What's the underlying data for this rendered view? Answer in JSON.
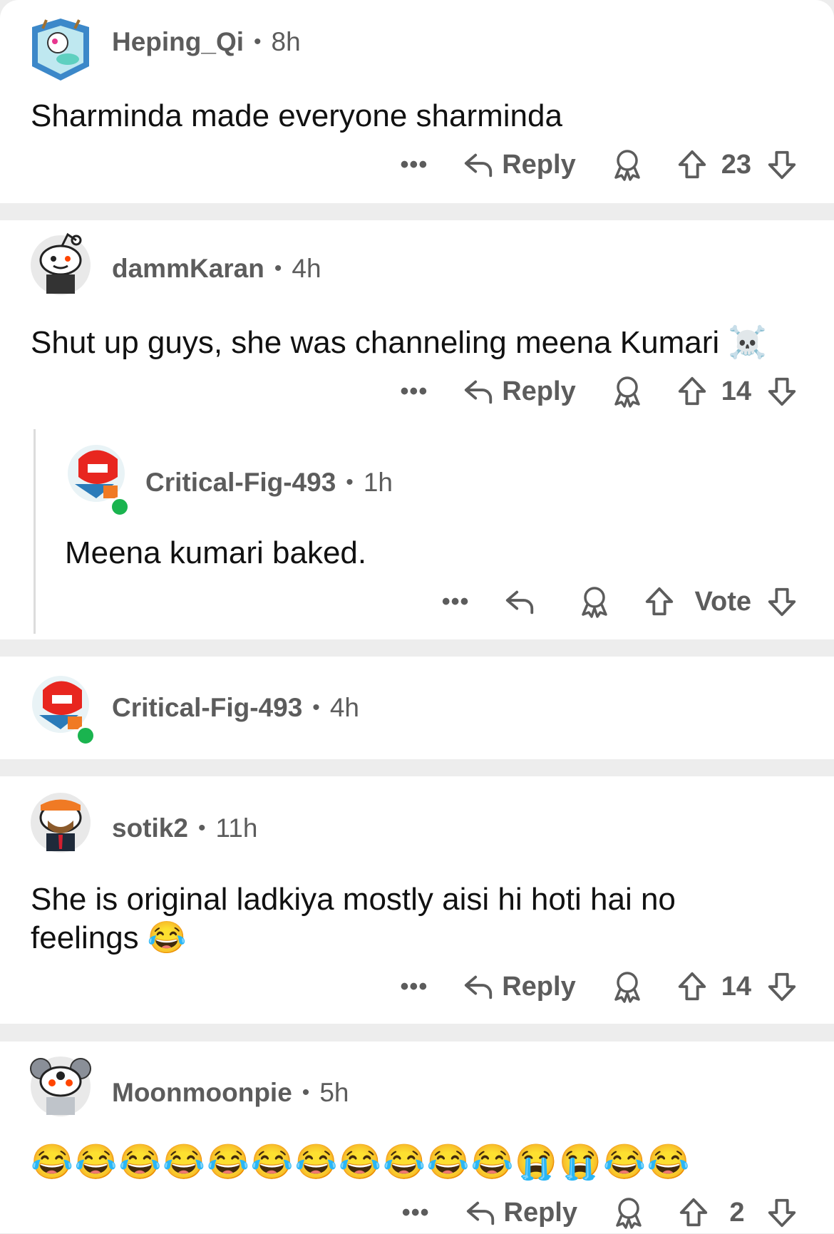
{
  "comments": [
    {
      "username": "Heping_Qi",
      "time": "8h",
      "text": "Sharminda made everyone sharminda",
      "actions": {
        "more": "•••",
        "reply": "Reply",
        "score": "23"
      }
    },
    {
      "username": "dammKaran",
      "time": "4h",
      "text": "Shut up guys, she was channeling meena Kumari",
      "emoji": "☠️",
      "actions": {
        "more": "•••",
        "reply": "Reply",
        "score": "14"
      },
      "replies": [
        {
          "username": "Critical-Fig-493",
          "time": "1h",
          "text": "Meena kumari baked.",
          "actions": {
            "more": "•••",
            "score": "Vote"
          }
        }
      ]
    },
    {
      "username": "Critical-Fig-493",
      "time": "4h"
    },
    {
      "username": "sotik2",
      "time": "11h",
      "text": "She is original ladkiya mostly aisi hi hoti hai no feelings",
      "emoji": "😂",
      "actions": {
        "more": "•••",
        "reply": "Reply",
        "score": "14"
      }
    },
    {
      "username": "Moonmoonpie",
      "time": "5h",
      "emojis": "😂😂😂😂😂😂😂😂😂😂😂😭😭😂😂",
      "actions": {
        "more": "•••",
        "reply": "Reply",
        "score": "2"
      }
    }
  ],
  "colors": {
    "divider": "#ededed",
    "text": "#111111",
    "meta": "#5c5c5c",
    "online": "#1ab44f"
  }
}
